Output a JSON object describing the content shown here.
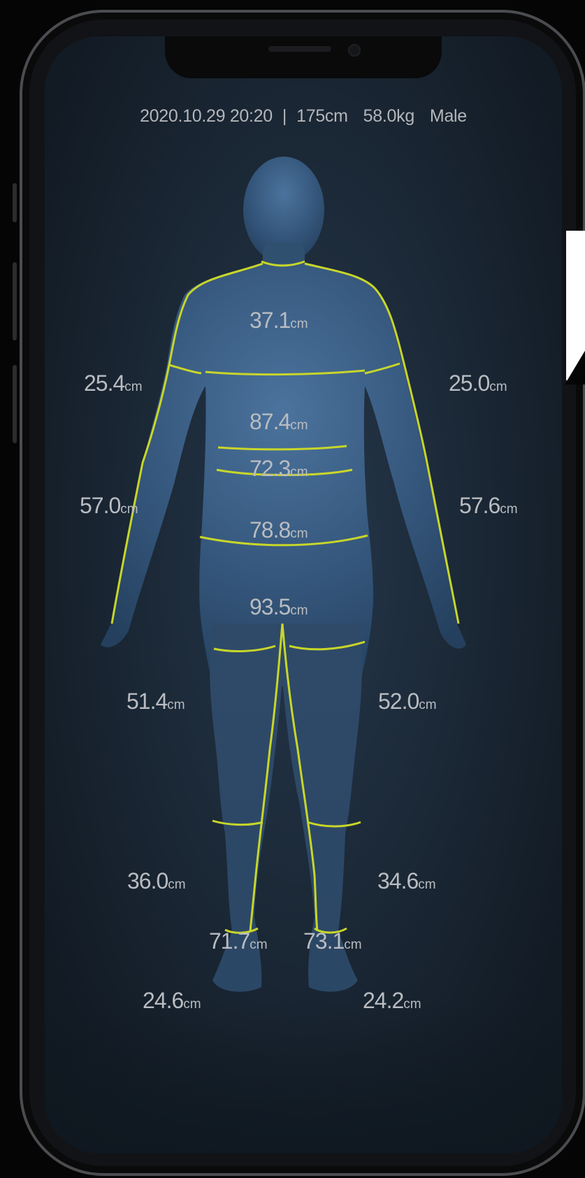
{
  "status_bar": {
    "datetime": "2020.10.29 20:20",
    "separator": "|",
    "height": "175cm",
    "weight": "58.0kg",
    "sex": "Male"
  },
  "measurements": {
    "neck": {
      "value": "37.1",
      "unit": "cm"
    },
    "upper_arm_right": {
      "value": "25.4",
      "unit": "cm"
    },
    "upper_arm_left": {
      "value": "25.0",
      "unit": "cm"
    },
    "chest": {
      "value": "87.4",
      "unit": "cm"
    },
    "waist": {
      "value": "72.3",
      "unit": "cm"
    },
    "arm_length_right": {
      "value": "57.0",
      "unit": "cm"
    },
    "arm_length_left": {
      "value": "57.6",
      "unit": "cm"
    },
    "abdomen": {
      "value": "78.8",
      "unit": "cm"
    },
    "hip": {
      "value": "93.5",
      "unit": "cm"
    },
    "thigh_right": {
      "value": "51.4",
      "unit": "cm"
    },
    "thigh_left": {
      "value": "52.0",
      "unit": "cm"
    },
    "calf_right": {
      "value": "36.0",
      "unit": "cm"
    },
    "calf_left": {
      "value": "34.6",
      "unit": "cm"
    },
    "inseam_right": {
      "value": "71.7",
      "unit": "cm"
    },
    "inseam_left": {
      "value": "73.1",
      "unit": "cm"
    },
    "ankle_right": {
      "value": "24.6",
      "unit": "cm"
    },
    "ankle_left": {
      "value": "24.2",
      "unit": "cm"
    }
  },
  "colors": {
    "measure_line": "#c8d62a",
    "body_fill": "#3a5d82",
    "background": "#1b2836"
  }
}
